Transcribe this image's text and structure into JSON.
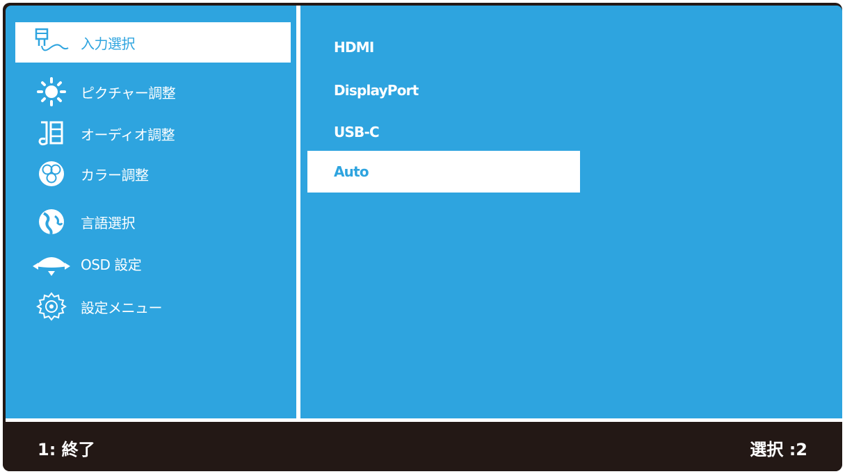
{
  "menu": {
    "items": [
      {
        "label": "入力選択",
        "icon": "input-select-icon"
      },
      {
        "label": "ピクチャー調整",
        "icon": "brightness-icon"
      },
      {
        "label": "オーディオ調整",
        "icon": "audio-icon"
      },
      {
        "label": "カラー調整",
        "icon": "rgb-color-icon"
      },
      {
        "label": "言語選択",
        "icon": "globe-icon"
      },
      {
        "label": "OSD 設定",
        "icon": "osd-icon"
      },
      {
        "label": "設定メニュー",
        "icon": "gear-icon"
      }
    ],
    "selected_index": 0
  },
  "submenu": {
    "items": [
      {
        "label": "HDMI"
      },
      {
        "label": "DisplayPort"
      },
      {
        "label": "USB-C"
      },
      {
        "label": "Auto"
      }
    ],
    "selected_index": 3
  },
  "footer": {
    "left": "1: 終了",
    "right": "選択 :2"
  },
  "colors": {
    "panel_bg": "#2ea4df",
    "footer_bg": "#231815",
    "highlight": "#ffffff",
    "text": "#ffffff"
  }
}
